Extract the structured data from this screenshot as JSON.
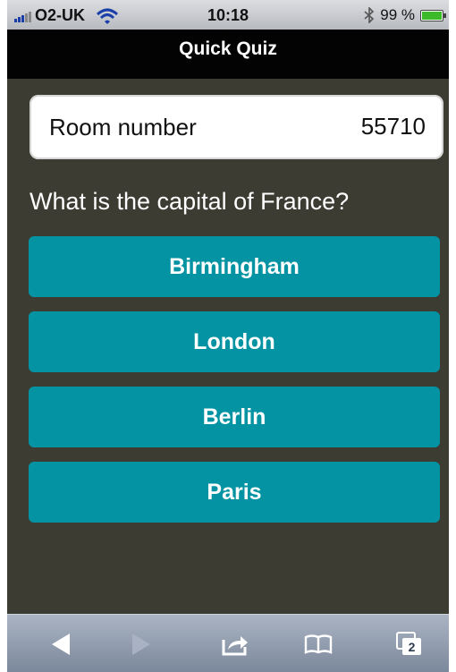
{
  "status_bar": {
    "carrier": "O2-UK",
    "time": "10:18",
    "battery_percent": "99 %",
    "battery_level": 0.99
  },
  "header": {
    "title": "Quick Quiz"
  },
  "room": {
    "label": "Room number",
    "value": "55710"
  },
  "quiz": {
    "question": "What is the capital of France?",
    "answers": [
      "Birmingham",
      "London",
      "Berlin",
      "Paris"
    ]
  },
  "toolbar": {
    "tabs_count": "2"
  },
  "colors": {
    "answer_button": "#0393a2",
    "background": "#3c3c33"
  }
}
